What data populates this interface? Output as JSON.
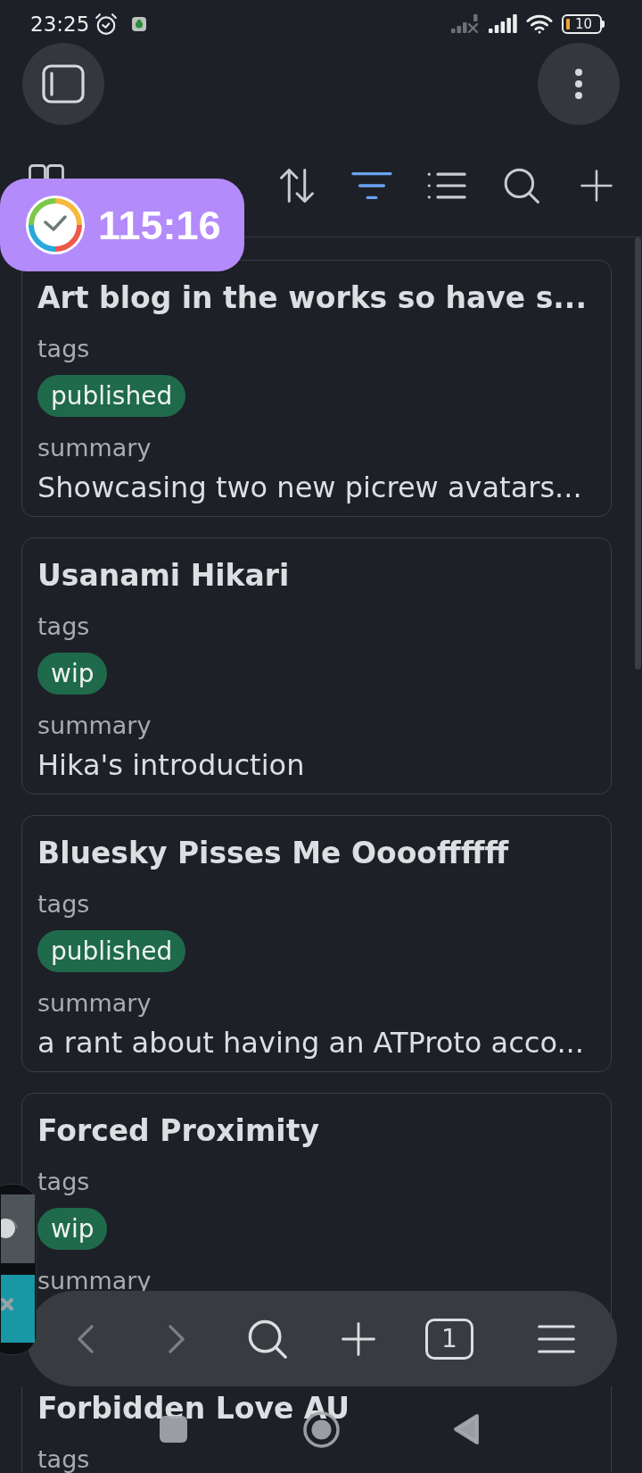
{
  "status_bar": {
    "time": "23:25",
    "battery": "10"
  },
  "toolbar": {
    "tools": [
      {
        "kind": "view",
        "active": false
      },
      {
        "kind": "sort",
        "active": false
      },
      {
        "kind": "filter",
        "active": true
      },
      {
        "kind": "list",
        "active": false
      },
      {
        "kind": "search",
        "active": false
      },
      {
        "kind": "add",
        "active": false
      }
    ]
  },
  "timer": {
    "time": "115:16"
  },
  "cards": [
    {
      "title": "Art blog in the works so have s...",
      "tags_label": "tags",
      "tags": [
        "published"
      ],
      "summary_label": "summary",
      "summary": "Showcasing two new picrew avatars..."
    },
    {
      "title": "Usanami Hikari",
      "tags_label": "tags",
      "tags": [
        "wip"
      ],
      "summary_label": "summary",
      "summary": "Hika's introduction"
    },
    {
      "title": "Bluesky Pisses Me Ooooffffff",
      "tags_label": "tags",
      "tags": [
        "published"
      ],
      "summary_label": "summary",
      "summary": "a rant about having an ATProto acco..."
    },
    {
      "title": "Forced Proximity",
      "tags_label": "tags",
      "tags": [
        "wip"
      ],
      "summary_label": "summary"
    },
    {
      "title": "Forbidden Love AU",
      "tags_label": "tags"
    }
  ],
  "browser_bar": {
    "buttons": [
      {
        "kind": "back",
        "disabled": true
      },
      {
        "kind": "forward",
        "disabled": true
      },
      {
        "kind": "search",
        "disabled": false
      },
      {
        "kind": "new_tab",
        "disabled": false
      },
      {
        "kind": "tabs",
        "disabled": false,
        "count": "1"
      },
      {
        "kind": "menu",
        "disabled": false
      }
    ]
  }
}
